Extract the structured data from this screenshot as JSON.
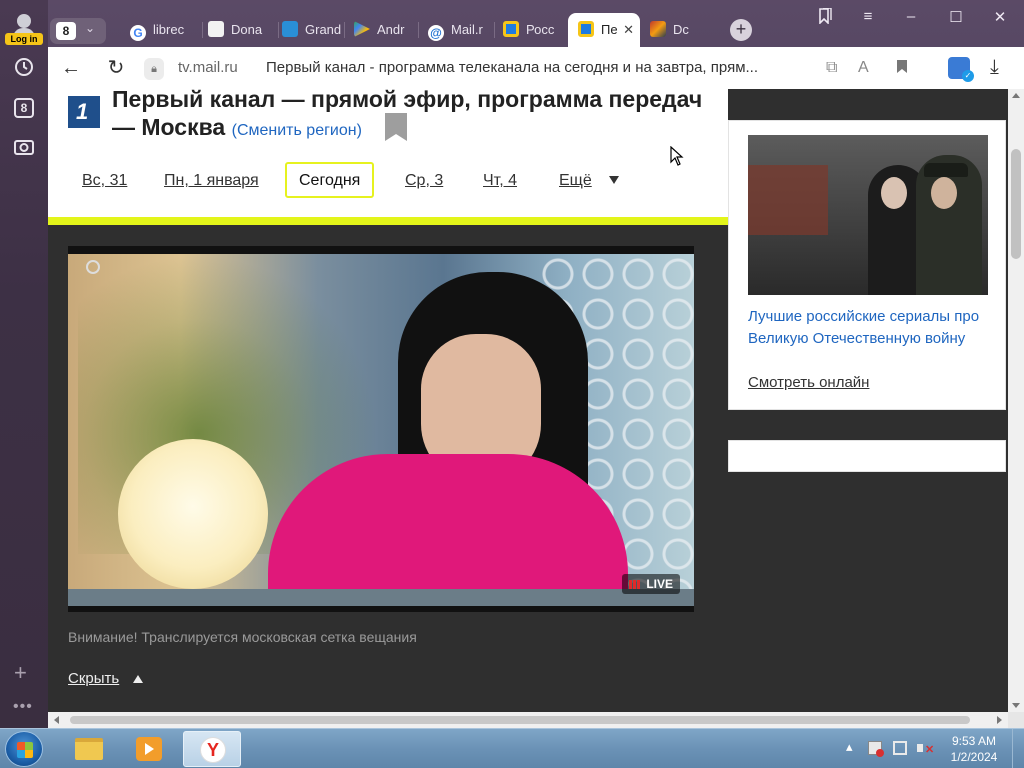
{
  "sidebar": {
    "login_label": "Log in",
    "tabs_count": "8"
  },
  "tabbar": {
    "tab_count": "8",
    "tabs": [
      {
        "label": "librec",
        "icon": "google-icon"
      },
      {
        "label": "Dona",
        "icon": "document-icon"
      },
      {
        "label": "Grand",
        "icon": "grand-icon"
      },
      {
        "label": "Andr",
        "icon": "play-store-icon"
      },
      {
        "label": "Mail.r",
        "icon": "mail-at-icon"
      },
      {
        "label": "Росс",
        "icon": "tv-icon"
      },
      {
        "label": "Пе",
        "icon": "tv-icon",
        "active": true
      },
      {
        "label": "Dc",
        "icon": "music-icon"
      }
    ]
  },
  "addressbar": {
    "host": "tv.mail.ru",
    "page_title": "Первый канал - программа телеканала на сегодня и на завтра, прям..."
  },
  "header": {
    "title_line1": "Первый канал — прямой эфир, программа передач",
    "title_line2": "— Москва",
    "region_link": "(Сменить регион)",
    "logo_char": "1"
  },
  "days": {
    "items": [
      "Вс, 31",
      "Пн, 1 января",
      "Сегодня",
      "Ср, 3",
      "Чт, 4",
      "Ещё"
    ],
    "selected": "Сегодня"
  },
  "player": {
    "live_label": "LIVE"
  },
  "notice": {
    "text": "Внимание! Транслируется московская сетка вещания",
    "hide_label": "Скрыть"
  },
  "side_card": {
    "title": "Лучшие российские сериалы про Великую Отечественную войну",
    "watch_link": "Смотреть онлайн"
  },
  "taskbar": {
    "time": "9:53 AM",
    "date": "1/2/2024"
  },
  "colors": {
    "accent_yellow": "#e3f51a",
    "link_blue": "#1f66c0",
    "logo_blue": "#1f4f8b",
    "live_red": "#e02a2a"
  }
}
